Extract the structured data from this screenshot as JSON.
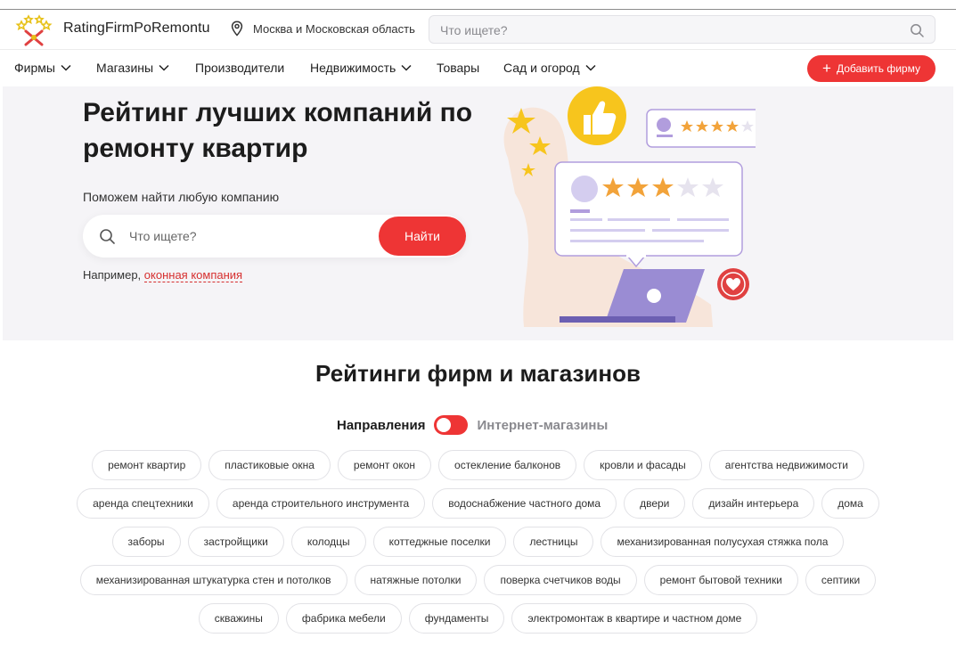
{
  "header": {
    "brand": "RatingFirmPoRemontu",
    "location": "Москва и Московская область",
    "search_placeholder": "Что ищете?"
  },
  "nav": {
    "items": [
      {
        "label": "Фирмы",
        "dropdown": true
      },
      {
        "label": "Магазины",
        "dropdown": true
      },
      {
        "label": "Производители",
        "dropdown": false
      },
      {
        "label": "Недвижимость",
        "dropdown": true
      },
      {
        "label": "Товары",
        "dropdown": false
      },
      {
        "label": "Сад и огород",
        "dropdown": true
      }
    ],
    "add_button": "Добавить фирму"
  },
  "hero": {
    "title": "Рейтинг лучших компаний по ремонту квартир",
    "subtitle": "Поможем найти любую компанию",
    "search_placeholder": "Что ищете?",
    "search_button": "Найти",
    "example_prefix": "Например,",
    "example_link": "оконная компания"
  },
  "ratings": {
    "title": "Рейтинги фирм и магазинов",
    "toggle_left": "Направления",
    "toggle_right": "Интернет-магазины",
    "tags": [
      "ремонт квартир",
      "пластиковые окна",
      "ремонт окон",
      "остекление балконов",
      "кровли и фасады",
      "агентства недвижимости",
      "аренда спецтехники",
      "аренда строительного инструмента",
      "водоснабжение частного дома",
      "двери",
      "дизайн интерьера",
      "дома",
      "заборы",
      "застройщики",
      "колодцы",
      "коттеджные поселки",
      "лестницы",
      "механизированная полусухая стяжка пола",
      "механизированная штукатурка стен и потолков",
      "натяжные потолки",
      "поверка счетчиков воды",
      "ремонт бытовой техники",
      "септики",
      "скважины",
      "фабрика мебели",
      "фундаменты",
      "электромонтаж в квартире и частном доме"
    ]
  },
  "colors": {
    "accent": "#ee3535",
    "star": "#f2a33a",
    "illustration_purple": "#b19ddd",
    "illustration_yellow": "#f7c51d"
  }
}
